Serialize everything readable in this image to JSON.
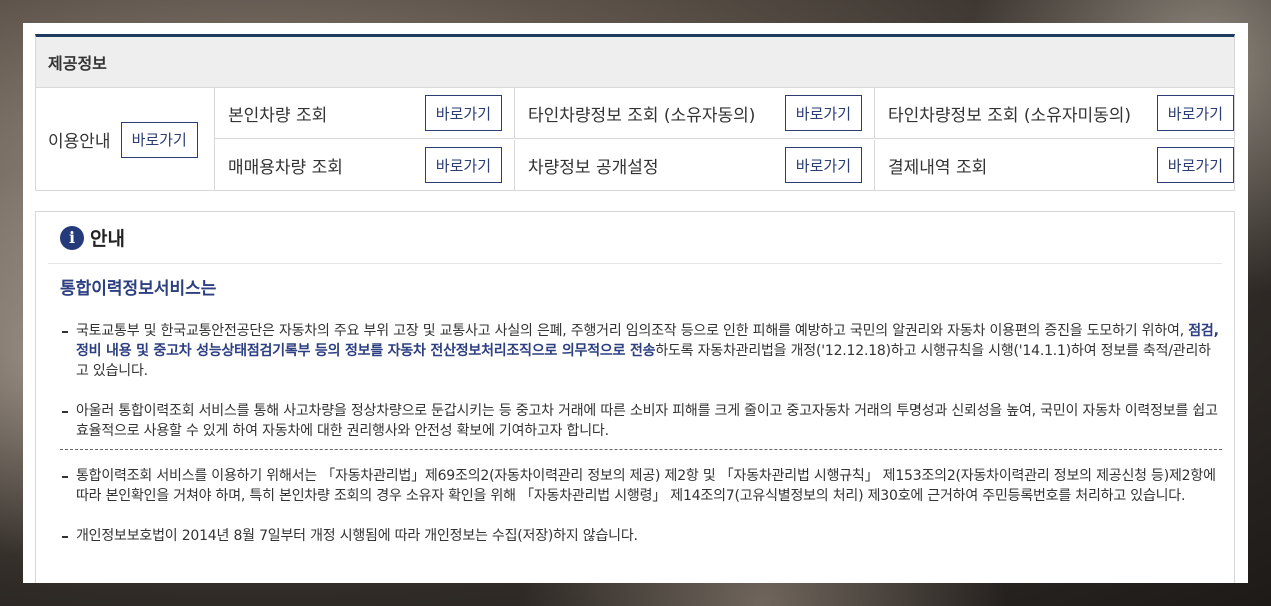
{
  "provided_info": {
    "title": "제공정보",
    "guide": {
      "label": "이용안내",
      "button": "바로가기"
    },
    "services": [
      {
        "label": "본인차량 조회",
        "button": "바로가기"
      },
      {
        "label": "타인차량정보 조회 (소유자동의)",
        "button": "바로가기"
      },
      {
        "label": "타인차량정보 조회 (소유자미동의)",
        "button": "바로가기"
      },
      {
        "label": "매매용차량 조회",
        "button": "바로가기"
      },
      {
        "label": "차량정보 공개설정",
        "button": "바로가기"
      },
      {
        "label": "결제내역 조회",
        "button": "바로가기"
      }
    ]
  },
  "notice": {
    "icon": "info-icon",
    "title": "안내",
    "subtitle": "통합이력정보서비스는",
    "p1_before": "국토교통부 및 한국교통안전공단은 자동차의 주요 부위 고장 및 교통사고 사실의 은폐, 주행거리 임의조작 등으로 인한 피해를 예방하고 국민의 알권리와 자동차 이용편의 증진을 도모하기 위하여, ",
    "p1_strong": "점검,정비 내용 및 중고차 성능상태점검기록부 등의 정보를 자동차 전산정보처리조직으로 의무적으로 전송",
    "p1_after": "하도록 자동차관리법을 개정('12.12.18)하고 시행규칙을 시행('14.1.1)하여 정보를 축적/관리하고 있습니다.",
    "p2": "아울러 통합이력조회 서비스를 통해 사고차량을 정상차량으로 둔갑시키는 등 중고차 거래에 따른 소비자 피해를 크게 줄이고 중고자동차 거래의 투명성과 신뢰성을 높여, 국민이 자동차 이력정보를 쉽고 효율적으로 사용할 수 있게 하여 자동차에 대한 권리행사와 안전성 확보에 기여하고자 합니다.",
    "p3": "통합이력조회 서비스를 이용하기 위해서는 「자동차관리법」제69조의2(자동차이력관리 정보의 제공) 제2항 및 「자동차관리법 시행규칙」 제153조의2(자동차이력관리 정보의 제공신청 등)제2항에 따라 본인확인을 거쳐야 하며, 특히 본인차량 조회의 경우 소유자 확인을 위해 「자동차관리법 시행령」 제14조의7(고유식별정보의 처리) 제30호에 근거하여 주민등록번호를 처리하고 있습니다.",
    "p4": "개인정보보호법이 2014년 8월 7일부터 개정 시행됨에 따라 개인정보는 수집(저장)하지 않습니다."
  }
}
